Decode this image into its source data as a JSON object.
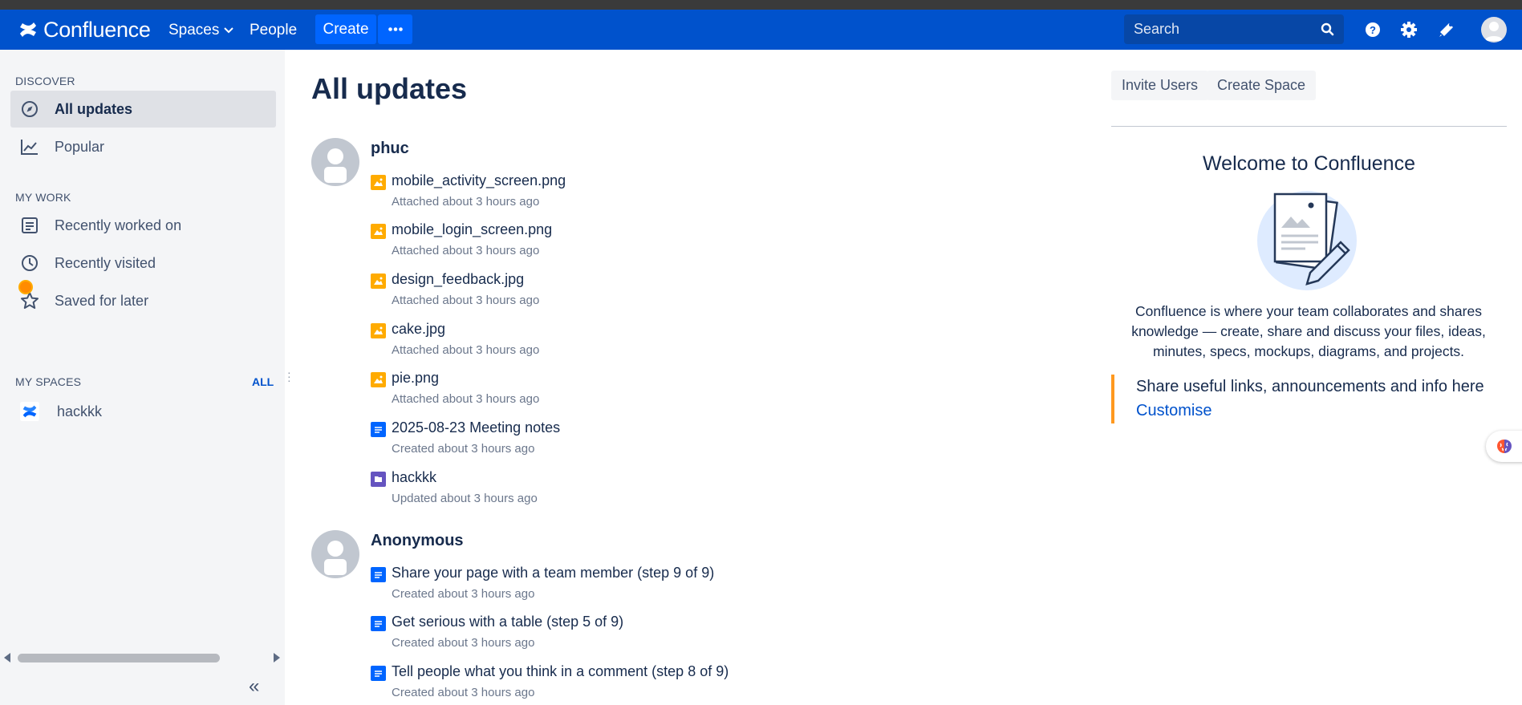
{
  "topbar": {
    "logo_text": "Confluence",
    "nav_spaces": "Spaces",
    "nav_people": "People",
    "create_label": "Create",
    "search_placeholder": "Search"
  },
  "sidebar": {
    "discover_header": "DISCOVER",
    "discover_items": [
      "All updates",
      "Popular"
    ],
    "mywork_header": "MY WORK",
    "mywork_items": [
      "Recently worked on",
      "Recently visited",
      "Saved for later"
    ],
    "myspaces_header": "MY SPACES",
    "all_link": "ALL",
    "spaces": [
      "hackkk"
    ]
  },
  "main": {
    "title": "All updates",
    "groups": [
      {
        "user": "phuc",
        "entries": [
          {
            "type": "image",
            "title": "mobile_activity_screen.png",
            "meta": "Attached about 3 hours ago"
          },
          {
            "type": "image",
            "title": "mobile_login_screen.png",
            "meta": "Attached about 3 hours ago"
          },
          {
            "type": "image",
            "title": "design_feedback.jpg",
            "meta": "Attached about 3 hours ago"
          },
          {
            "type": "image",
            "title": "cake.jpg",
            "meta": "Attached about 3 hours ago"
          },
          {
            "type": "image",
            "title": "pie.png",
            "meta": "Attached about 3 hours ago"
          },
          {
            "type": "page",
            "title": "2025-08-23 Meeting notes",
            "meta": "Created about 3 hours ago"
          },
          {
            "type": "space",
            "title": "hackkk",
            "meta": "Updated about 3 hours ago"
          }
        ]
      },
      {
        "user": "Anonymous",
        "entries": [
          {
            "type": "page",
            "title": "Share your page with a team member (step 9 of 9)",
            "meta": "Created about 3 hours ago"
          },
          {
            "type": "page",
            "title": "Get serious with a table (step 5 of 9)",
            "meta": "Created about 3 hours ago"
          },
          {
            "type": "page",
            "title": "Tell people what you think in a comment (step 8 of 9)",
            "meta": "Created about 3 hours ago"
          }
        ]
      }
    ]
  },
  "right_panel": {
    "invite_users": "Invite Users",
    "create_space": "Create Space",
    "welcome_title": "Welcome to Confluence",
    "welcome_text": "Confluence is where your team collaborates and shares knowledge — create, share and discuss your files, ideas, minutes, specs, mockups, diagrams, and projects.",
    "share_text": "Share useful links, announcements and info here",
    "customise": "Customise"
  },
  "colors": {
    "topbar": "#0052cc",
    "create_button": "#0065ff",
    "image_icon": "#ffab00",
    "page_icon": "#0065ff",
    "space_icon": "#6554c0",
    "share_accent": "#ff991f"
  }
}
